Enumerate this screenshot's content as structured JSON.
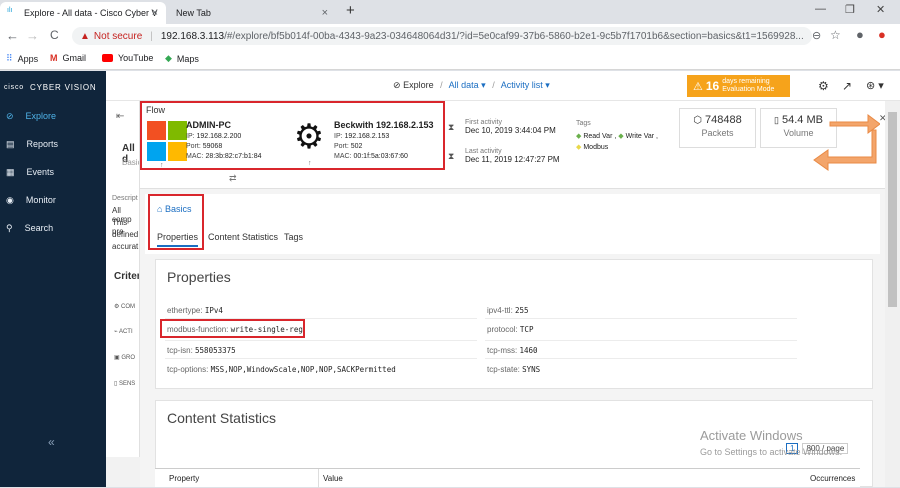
{
  "browser": {
    "tabs": [
      {
        "title": "Explore - All data - Cisco Cyber V",
        "close": "×"
      },
      {
        "title": "New Tab",
        "close": "×"
      }
    ],
    "new_tab": "+",
    "window_controls": {
      "minimize": "—",
      "restore": "❐",
      "close": "✕"
    },
    "nav": {
      "back": "←",
      "forward": "→",
      "reload": "C"
    },
    "address": {
      "warning_icon": "▲",
      "security_label": "Not secure",
      "separator": "|",
      "host": "192.168.3.113",
      "path": "/#/explore/bf5b014f-00ba-4343-9a23-034648064d31/?id=5e0caf99-37b6-5860-b2e1-9c5b7f1701b6&section=basics&t1=1569928...",
      "icons": {
        "zoom": "⊖",
        "star": "☆",
        "profile": "●",
        "extension": "●"
      }
    },
    "bookmarks": [
      {
        "label": "Apps",
        "icon": "apps-grid-icon"
      },
      {
        "label": "Gmail",
        "icon": "gmail-icon"
      },
      {
        "label": "YouTube",
        "icon": "youtube-icon"
      },
      {
        "label": "Maps",
        "icon": "maps-icon"
      }
    ]
  },
  "sidebar": {
    "logo": "cisco",
    "brand": "CYBER VISION",
    "items": [
      {
        "label": "Explore",
        "icon": "explore-icon",
        "glyph": "⊘"
      },
      {
        "label": "Reports",
        "icon": "reports-icon",
        "glyph": "▤"
      },
      {
        "label": "Events",
        "icon": "events-icon",
        "glyph": "▦"
      },
      {
        "label": "Monitor",
        "icon": "monitor-icon",
        "glyph": "◉"
      },
      {
        "label": "Search",
        "icon": "search-icon",
        "glyph": "⚲"
      }
    ],
    "collapse": "«"
  },
  "topbar": {
    "explore": "Explore",
    "all_data": "All data ▾",
    "activity_list": "Activity list ▾",
    "slash": "/",
    "eval": {
      "icon": "⚠",
      "days": "16",
      "line1": "days remaining",
      "line2": "Evaluation Mode"
    },
    "icons": {
      "settings": "⚙",
      "chart": "↗",
      "user": "⊛ ▾"
    }
  },
  "left_panel": {
    "title": "All d",
    "sub": "Basic",
    "desc_label": "Descript",
    "desc_lines": [
      "All comp",
      "This pre",
      "defined",
      "accurat"
    ],
    "criteria": "Criteri",
    "items": [
      "COM",
      "ACTI",
      "GRO",
      "SENS"
    ]
  },
  "flow": {
    "label": "Flow",
    "source": {
      "name": "ADMIN-PC",
      "ip_label": "IP:",
      "ip": "192.168.2.200",
      "port_label": "Port:",
      "port": "59068",
      "mac_label": "MAC:",
      "mac": "28:3b:82:c7:b1:84"
    },
    "dest": {
      "name": "Beckwith 192.168.2.153",
      "ip_label": "IP:",
      "ip": "192.168.2.153",
      "port_label": "Port:",
      "port": "502",
      "mac_label": "MAC:",
      "mac": "00:1f:5a:03:67:60"
    },
    "swap": "⇄",
    "first_activity_label": "First activity",
    "first_activity": "Dec 10, 2019 3:44:04 PM",
    "last_activity_label": "Last activity",
    "last_activity": "Dec 11, 2019 12:47:27 PM",
    "tags_label": "Tags",
    "tags": [
      "Read Var ,",
      "Write Var ,",
      "Modbus"
    ],
    "packets_value": "748488",
    "packets_label": "Packets",
    "volume_value": "54.4 MB",
    "volume_label": "Volume",
    "close": "✕"
  },
  "detail": {
    "basics": "Basics",
    "tabs": [
      "Properties",
      "Content Statistics",
      "Tags"
    ],
    "properties_title": "Properties",
    "props_left": [
      {
        "k": "ethertype:",
        "v": "IPv4"
      },
      {
        "k": "modbus-function:",
        "v": "write-single-reg"
      },
      {
        "k": "tcp-isn:",
        "v": "558053375"
      },
      {
        "k": "tcp-options:",
        "v": "MSS,NOP,WindowScale,NOP,NOP,SACKPermitted"
      }
    ],
    "props_right": [
      {
        "k": "ipv4-ttl:",
        "v": "255"
      },
      {
        "k": "protocol:",
        "v": "TCP"
      },
      {
        "k": "tcp-mss:",
        "v": "1460"
      },
      {
        "k": "tcp-state:",
        "v": "SYNS"
      }
    ],
    "content_stats_title": "Content Statistics",
    "pagination": {
      "page": "1",
      "per_page": "800 / page"
    },
    "table_headers": [
      "Property",
      "Value",
      "Occurrences"
    ]
  },
  "watermark": {
    "line1": "Activate Windows",
    "line2": "Go to Settings to activate Windows."
  }
}
